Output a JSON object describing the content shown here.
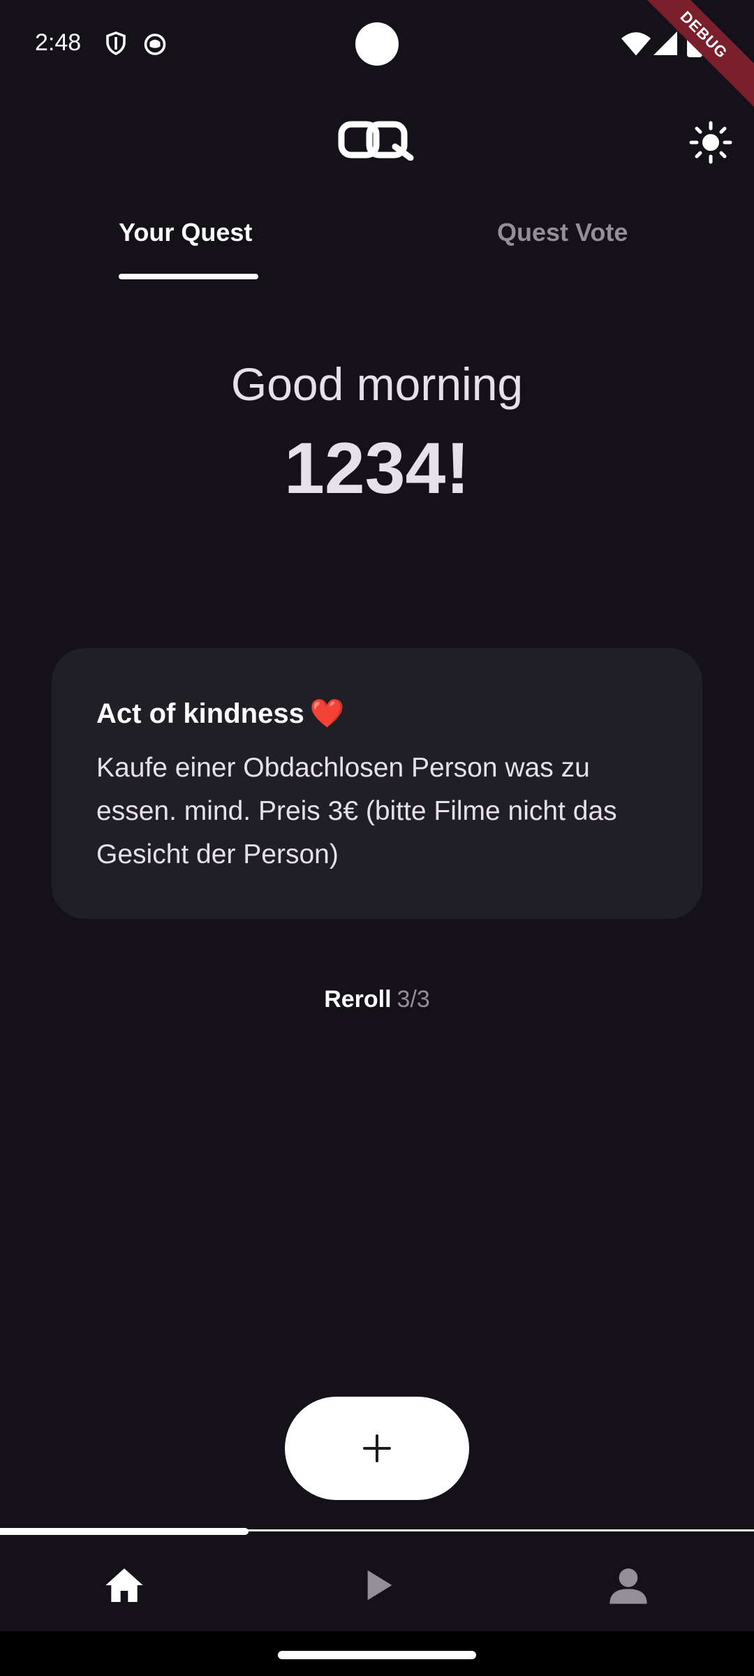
{
  "status_bar": {
    "time": "2:48",
    "left_icons": [
      "shield-icon",
      "cat-face-icon"
    ],
    "right_icons": [
      "wifi-icon",
      "cellular-signal-icon",
      "battery-icon"
    ]
  },
  "debug_banner": "DEBUG",
  "header": {
    "logo_icon": "app-logo-icon",
    "theme_toggle_icon": "sun-icon"
  },
  "tabs": [
    {
      "label": "Your Quest",
      "selected": true
    },
    {
      "label": "Quest Vote",
      "selected": false
    }
  ],
  "greeting": {
    "salutation": "Good morning",
    "name": "1234!"
  },
  "quest_card": {
    "title": "Act of kindness",
    "emoji": "❤️",
    "description": "Kaufe einer Obdachlosen Person was zu essen. mind. Preis 3€ (bitte Filme nicht das Gesicht der Person)"
  },
  "reroll": {
    "label": "Reroll",
    "count": "3/3"
  },
  "fab": {
    "icon": "plus-icon"
  },
  "progress": {
    "fraction": 0.33
  },
  "bottom_nav": [
    {
      "icon": "home-icon",
      "selected": true
    },
    {
      "icon": "play-icon",
      "selected": false
    },
    {
      "icon": "person-icon",
      "selected": false
    }
  ],
  "colors": {
    "background": "#141218",
    "card": "#211f26",
    "accent": "#ffffff",
    "muted": "#938f99",
    "heart": "#e53935"
  }
}
